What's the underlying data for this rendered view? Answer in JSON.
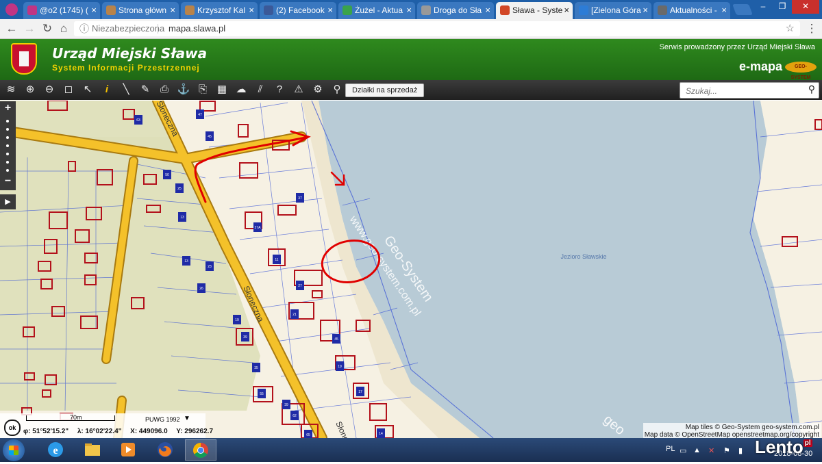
{
  "browser": {
    "tabs": [
      {
        "title": "@o2 (1745) (",
        "favicon": "instagram-icon",
        "color": "#c13584"
      },
      {
        "title": "Strona główn",
        "favicon": "site-icon",
        "color": "#b8834a"
      },
      {
        "title": "Krzysztof Kal",
        "favicon": "site-icon",
        "color": "#b8834a"
      },
      {
        "title": "(2) Facebook",
        "favicon": "facebook-icon",
        "color": "#3b5998"
      },
      {
        "title": "Żużel - Aktua",
        "favicon": "sf-icon",
        "color": "#3aa34a"
      },
      {
        "title": "Droga do Sła",
        "favicon": "document-icon",
        "color": "#999999"
      },
      {
        "title": "Sława - Syste",
        "favicon": "map-icon",
        "color": "#d24726",
        "active": true
      },
      {
        "title": "[Zielona Góra",
        "favicon": "site-icon",
        "color": "#2d7cd6"
      },
      {
        "title": "Aktualności -",
        "favicon": "site-icon",
        "color": "#6a6a6a"
      }
    ],
    "address": {
      "security_label": "Niezabezpieczona",
      "host": "mapa.slawa.pl"
    }
  },
  "header": {
    "title": "Urząd Miejski Sława",
    "subtitle": "System Informacji Przestrzennej",
    "service_text": "Serwis prowadzony przez Urząd Miejski Sława",
    "brand": "e-mapa",
    "geosystem_logo": "GEO-SYSTEM"
  },
  "toolbar": {
    "tools": [
      "layers-icon",
      "zoom-in-icon",
      "zoom-out-icon",
      "zoom-extent-icon",
      "select-icon",
      "info-icon",
      "measure-icon",
      "clip-icon",
      "print-icon",
      "pin-icon",
      "export-icon",
      "layout-icon",
      "annotate-icon",
      "hatch-icon",
      "help-icon",
      "warning-icon",
      "settings-icon",
      "location-icon"
    ],
    "dzialki_label": "Działki na sprzedaż",
    "search_placeholder": "Szukaj..."
  },
  "map": {
    "street_names": [
      "Słoneczna",
      "Słoneczna",
      "Słoneczna"
    ],
    "lake_name": "Jezioro Sławskie",
    "watermark_text": "Geo-System",
    "watermark_url": "www.geo-system.com.pl",
    "watermark_corner": "geo",
    "house_numbers": [
      "63",
      "47",
      "45",
      "50",
      "25",
      "37",
      "26",
      "19",
      "27A",
      "11",
      "13",
      "23",
      "27",
      "21",
      "35",
      "17",
      "39",
      "55",
      "45",
      "19",
      "65",
      "13",
      "62",
      "39",
      "14"
    ],
    "colors": {
      "land": "#f6f1e3",
      "water": "#b8cbd6",
      "green_area": "#dedfb8",
      "road": "#f4c12a",
      "road_border": "#a87a10",
      "building": "#b3111b",
      "address_box": "#1f2ba6",
      "parcel": "#3a55d6",
      "annotation": "#e00000"
    }
  },
  "scale": {
    "label": "70m",
    "projection": "PUWG 1992",
    "phi": "φ: 51°52'15.2\"",
    "lambda": "λ: 16°02'22.4\"",
    "x": "X: 449096.0",
    "y": "Y: 296262.7"
  },
  "attribution": {
    "line1": "Map tiles © Geo-System geo-system.com.pl",
    "line2": "Map data © OpenStreetMap openstreetmap.org/copyright"
  },
  "taskbar": {
    "apps": [
      "ie-icon",
      "explorer-icon",
      "media-player-icon",
      "firefox-icon",
      "chrome-icon"
    ],
    "language": "PL",
    "date": "2018-08-30",
    "watermark": "Lento",
    "watermark_tld": "pl"
  }
}
